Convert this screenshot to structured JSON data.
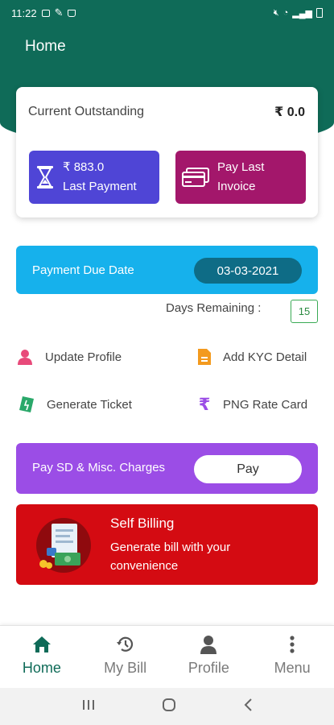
{
  "status_bar": {
    "time": "11:22"
  },
  "header": {
    "title": "Home"
  },
  "outstanding": {
    "label": "Current Outstanding",
    "value": "₹ 0.0",
    "last_payment": {
      "amount": "₹ 883.0",
      "label": "Last Payment",
      "icon": "hourglass-icon"
    },
    "pay_invoice": {
      "line1": "Pay Last",
      "line2": "Invoice",
      "icon": "credit-card-icon"
    }
  },
  "due": {
    "label": "Payment Due Date",
    "date": "03-03-2021"
  },
  "days_remaining": {
    "label": "Days Remaining :",
    "value": "15"
  },
  "actions": [
    {
      "label": "Update Profile",
      "icon": "user-icon"
    },
    {
      "label": "Add KYC Detail",
      "icon": "document-icon"
    },
    {
      "label": "Generate Ticket",
      "icon": "ticket-icon"
    },
    {
      "label": "PNG Rate Card",
      "icon": "rupee-icon"
    }
  ],
  "pay_sd": {
    "label": "Pay SD & Misc. Charges",
    "button": "Pay"
  },
  "self_billing": {
    "title": "Self Billing",
    "subtitle": "Generate bill with your convenience",
    "icon": "bill-illustration-icon"
  },
  "bottom_nav": [
    {
      "label": "Home",
      "icon": "home-icon",
      "active": true
    },
    {
      "label": "My Bill",
      "icon": "history-icon",
      "active": false
    },
    {
      "label": "Profile",
      "icon": "person-icon",
      "active": false
    },
    {
      "label": "Menu",
      "icon": "more-vertical-icon",
      "active": false
    }
  ],
  "colors": {
    "primary": "#0f6b58",
    "last_payment_tile": "#4f45d6",
    "invoice_tile": "#a3176b",
    "due_bar": "#16b1ec",
    "due_date_pill": "#0e6c86",
    "pay_bar": "#9b4de6",
    "self_billing": "#d40b12"
  }
}
